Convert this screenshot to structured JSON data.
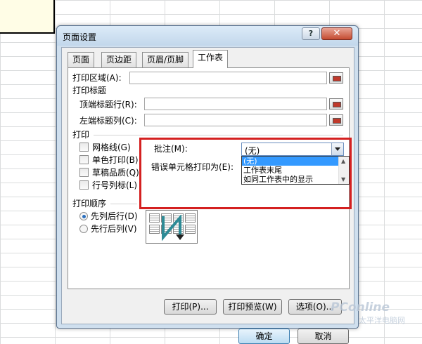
{
  "dialog": {
    "title": "页面设置"
  },
  "titlebar_buttons": {
    "help": "?",
    "close": "✕"
  },
  "tabs": [
    {
      "label": "页面"
    },
    {
      "label": "页边距"
    },
    {
      "label": "页眉/页脚"
    },
    {
      "label": "工作表",
      "active": true
    }
  ],
  "print_area": {
    "label": "打印区域(A):",
    "value": ""
  },
  "print_titles": {
    "heading": "打印标题",
    "top_rows_label": "顶端标题行(R):",
    "top_rows_value": "",
    "left_cols_label": "左端标题列(C):",
    "left_cols_value": ""
  },
  "print": {
    "heading": "打印",
    "options": [
      {
        "label": "网格线(G)",
        "checked": false
      },
      {
        "label": "单色打印(B)",
        "checked": false
      },
      {
        "label": "草稿品质(Q)",
        "checked": false
      },
      {
        "label": "行号列标(L)",
        "checked": false
      }
    ],
    "comments_label": "批注(M):",
    "comments_value": "(无)",
    "comments_options": [
      "(无)",
      "工作表末尾",
      "如同工作表中的显示"
    ],
    "errors_label": "错误单元格打印为(E):"
  },
  "page_order": {
    "heading": "打印顺序",
    "options": [
      {
        "label": "先列后行(D)",
        "selected": true
      },
      {
        "label": "先行后列(V)",
        "selected": false
      }
    ]
  },
  "actions": {
    "print": "打印(P)...",
    "preview": "打印预览(W)",
    "options": "选项(O)..."
  },
  "footer": {
    "ok": "确定",
    "cancel": "取消"
  },
  "watermark": {
    "brand": "PConline",
    "sub": "太平洋电脑网"
  },
  "colors": {
    "highlight": "#d42020",
    "selection": "#3399ff"
  }
}
